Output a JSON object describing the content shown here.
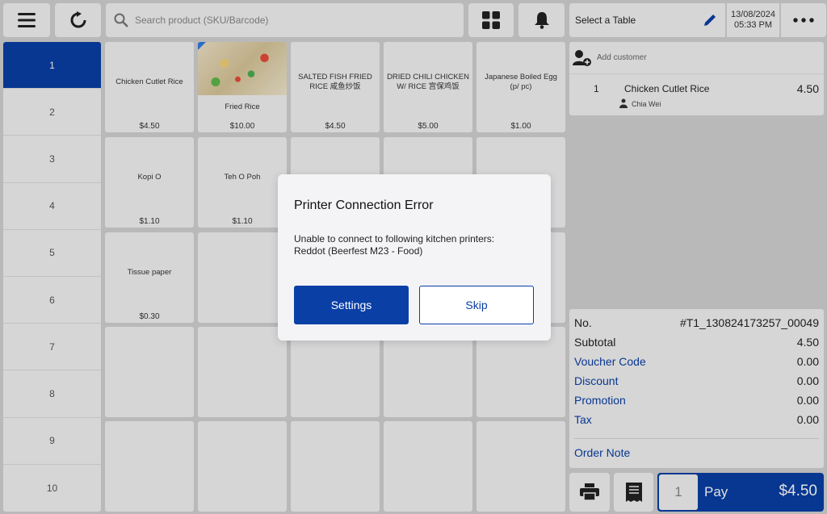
{
  "toolbar": {
    "search_placeholder": "Search product (SKU/Barcode)",
    "select_table_label": "Select a Table",
    "date": "13/08/2024",
    "time": "05:33 PM"
  },
  "categories": [
    "1",
    "2",
    "3",
    "4",
    "5",
    "6",
    "7",
    "8",
    "9",
    "10"
  ],
  "products": [
    {
      "name": "Chicken Cutlet Rice",
      "price": "$4.50"
    },
    {
      "name": "Fried Rice",
      "price": "$10.00"
    },
    {
      "name": "SALTED FISH FRIED RICE 咸鱼炒饭",
      "price": "$4.50"
    },
    {
      "name": "DRIED CHILI CHICKEN W/ RICE 宫保鸡饭",
      "price": "$5.00"
    },
    {
      "name": "Japanese Boiled Egg (p/ pc)",
      "price": "$1.00"
    },
    {
      "name": "Kopi O",
      "price": "$1.10"
    },
    {
      "name": "Teh O Poh",
      "price": "$1.10"
    },
    {
      "name": "Tissue paper",
      "price": "$0.30"
    }
  ],
  "order": {
    "add_customer_label": "Add customer",
    "item": {
      "qty": "1",
      "name": "Chicken Cutlet Rice",
      "price": "4.50",
      "staff": "Chia Wei"
    }
  },
  "summary": {
    "no_label": "No.",
    "no_value": "#T1_130824173257_00049",
    "subtotal_label": "Subtotal",
    "subtotal_value": "4.50",
    "voucher_label": "Voucher Code",
    "voucher_value": "0.00",
    "discount_label": "Discount",
    "discount_value": "0.00",
    "promotion_label": "Promotion",
    "promotion_value": "0.00",
    "tax_label": "Tax",
    "tax_value": "0.00",
    "order_note_label": "Order Note"
  },
  "pay": {
    "qty": "1",
    "label": "Pay",
    "amount": "$4.50"
  },
  "modal": {
    "title": "Printer Connection Error",
    "message_line1": "Unable to connect to following kitchen printers:",
    "message_line2": "Reddot (Beerfest M23 - Food)",
    "settings_label": "Settings",
    "skip_label": "Skip"
  },
  "colors": {
    "accent": "#0a3fa6",
    "background": "#d3d3d3",
    "panel": "#f4f4f4"
  },
  "icons": [
    "menu-icon",
    "refresh-icon",
    "search-icon",
    "grid-icon",
    "bell-icon",
    "pencil-icon",
    "more-icon",
    "add-customer-icon",
    "staff-icon",
    "printer-icon",
    "receipt-icon"
  ]
}
